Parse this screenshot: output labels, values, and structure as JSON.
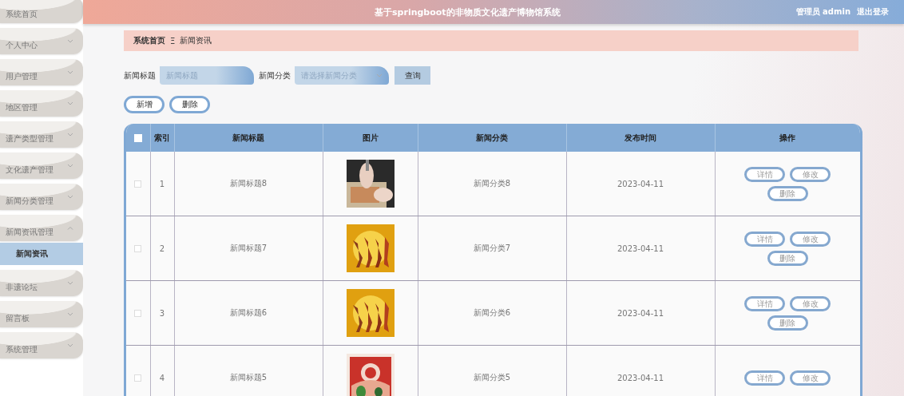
{
  "sidebar": {
    "items": [
      {
        "label": "系统首页",
        "kind": "link"
      },
      {
        "label": "个人中心",
        "kind": "menu",
        "expanded": false
      },
      {
        "label": "用户管理",
        "kind": "menu",
        "expanded": false
      },
      {
        "label": "地区管理",
        "kind": "menu",
        "expanded": false
      },
      {
        "label": "遗产类型管理",
        "kind": "menu",
        "expanded": false
      },
      {
        "label": "文化遗产管理",
        "kind": "menu",
        "expanded": false
      },
      {
        "label": "新闻分类管理",
        "kind": "menu",
        "expanded": false
      },
      {
        "label": "新闻资讯管理",
        "kind": "menu",
        "expanded": true,
        "children": [
          {
            "label": "新闻资讯",
            "selected": true
          }
        ]
      },
      {
        "label": "非遗论坛",
        "kind": "menu",
        "expanded": false
      },
      {
        "label": "留言板",
        "kind": "menu",
        "expanded": false
      },
      {
        "label": "系统管理",
        "kind": "menu",
        "expanded": false
      }
    ]
  },
  "header": {
    "title": "基于springboot的非物质文化遗产博物馆系统",
    "user": "管理员 admin",
    "logout": "退出登录"
  },
  "breadcrumb": [
    "系统首页",
    "新闻资讯"
  ],
  "breadcrumb_separator": "Ξ",
  "search": {
    "fields": [
      {
        "label": "新闻标题",
        "placeholder": "新闻标题",
        "kind": "text"
      },
      {
        "label": "新闻分类",
        "placeholder": "请选择新闻分类",
        "kind": "select"
      }
    ],
    "button": "查询"
  },
  "actions": [
    "新增",
    "删除"
  ],
  "table": {
    "select_all": {
      "checked": false
    },
    "columns": [
      "索引",
      "新闻标题",
      "图片",
      "新闻分类",
      "发布时间",
      "操作"
    ],
    "rows": [
      {
        "checked": false,
        "index": "1",
        "title": "新闻标题8",
        "image": {
          "kind": "picture"
        },
        "category": "新闻分类8",
        "date": "2023-04-11",
        "buttons": [
          "详情",
          "修改",
          "删除"
        ]
      },
      {
        "checked": false,
        "index": "2",
        "title": "新闻标题7",
        "image": {
          "kind": "picture"
        },
        "category": "新闻分类7",
        "date": "2023-04-11",
        "buttons": [
          "详情",
          "修改",
          "删除"
        ]
      },
      {
        "checked": false,
        "index": "3",
        "title": "新闻标题6",
        "image": {
          "kind": "picture"
        },
        "category": "新闻分类6",
        "date": "2023-04-11",
        "buttons": [
          "详情",
          "修改",
          "删除"
        ]
      },
      {
        "checked": false,
        "index": "4",
        "title": "新闻标题5",
        "image": {
          "kind": "picture"
        },
        "category": "新闻分类5",
        "date": "2023-04-11",
        "buttons": [
          "详情",
          "修改"
        ]
      }
    ]
  }
}
